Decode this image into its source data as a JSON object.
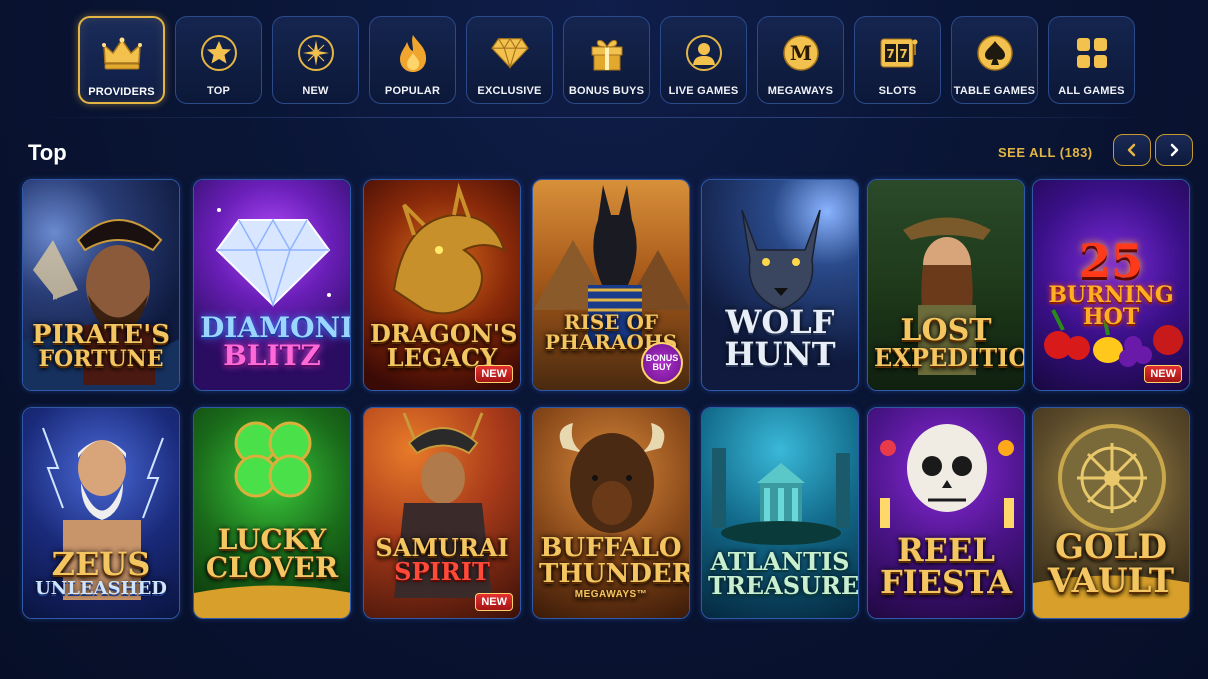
{
  "nav": {
    "categories": [
      {
        "label": "PROVIDERS",
        "icon": "crown-icon",
        "active": true
      },
      {
        "label": "TOP",
        "icon": "star-icon"
      },
      {
        "label": "NEW",
        "icon": "sparkle-icon"
      },
      {
        "label": "POPULAR",
        "icon": "flame-icon"
      },
      {
        "label": "EXCLUSIVE",
        "icon": "diamond-icon"
      },
      {
        "label": "BONUS BUYS",
        "icon": "gift-icon"
      },
      {
        "label": "LIVE GAMES",
        "icon": "dealer-icon"
      },
      {
        "label": "MEGAWAYS",
        "icon": "megaways-icon"
      },
      {
        "label": "SLOTS",
        "icon": "slot-machine-icon"
      },
      {
        "label": "TABLE GAMES",
        "icon": "spade-icon"
      },
      {
        "label": "ALL GAMES",
        "icon": "grid-icon"
      }
    ]
  },
  "section": {
    "title": "Top",
    "see_all": "SEE ALL (183)"
  },
  "games": [
    {
      "title": [
        "PIRATE'S",
        "FORTUNE"
      ]
    },
    {
      "title": [
        "DIAMOND",
        "BLITZ"
      ]
    },
    {
      "title": [
        "DRAGON'S",
        "LEGACY"
      ],
      "badge": "NEW"
    },
    {
      "title": [
        "RISE OF",
        "PHARAOHS"
      ],
      "bonus_badge": [
        "BONUS",
        "BUY"
      ]
    },
    {
      "title": [
        "WOLF",
        "HUNT"
      ]
    },
    {
      "title": [
        "LOST",
        "EXPEDITION"
      ]
    },
    {
      "title": [
        "25",
        "BURNING",
        "HOT"
      ],
      "badge": "NEW"
    },
    {
      "title": [
        "ZEUS",
        "UNLEASHED"
      ]
    },
    {
      "title": [
        "LUCKY",
        "CLOVER"
      ]
    },
    {
      "title": [
        "SAMURAI",
        "SPIRIT"
      ],
      "badge": "NEW"
    },
    {
      "title": [
        "BUFFALO",
        "THUNDER"
      ],
      "subtitle": "MEGAWAYS™"
    },
    {
      "title": [
        "ATLANTIS",
        "TREASURE"
      ]
    },
    {
      "title": [
        "REEL",
        "FIESTA"
      ]
    },
    {
      "title": [
        "GOLD",
        "VAULT"
      ]
    }
  ],
  "colors": {
    "accent_gold": "#e3b544",
    "card_border": "#2f5aa8",
    "background": "#0a1535",
    "badge_red": "#d42525"
  }
}
